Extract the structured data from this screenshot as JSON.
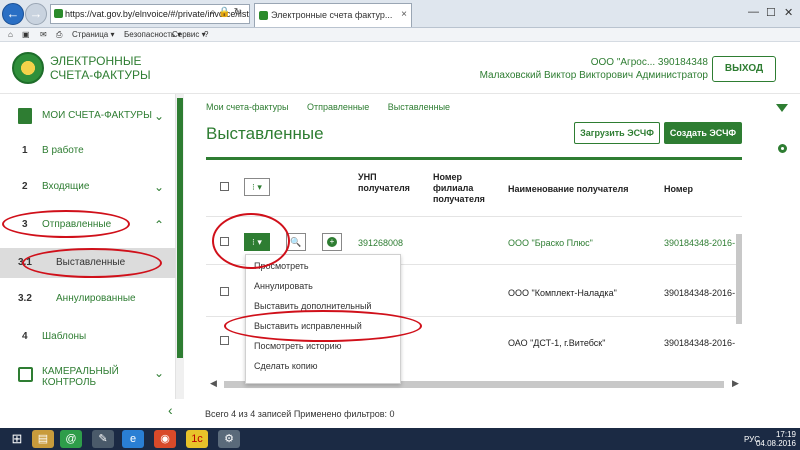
{
  "browser": {
    "url": "https://vat.gov.by/elnvoice/#/private/invoice/listAll?_k=9zpzd",
    "tab_title": "Электронные счета фактур...",
    "tab_close": "×",
    "minimize": "—",
    "maximize": "☐",
    "close": "✕",
    "cmd": {
      "page": "Страница ▾",
      "security": "Безопасность ▾",
      "service": "Сервис ▾"
    }
  },
  "header": {
    "brand": "ЭЛЕКТРОННЫЕ СЧЕТА-ФАКТУРЫ",
    "company": "ООО \"Агрос...  390184348",
    "user": "Малаховский Виктор Викторович Администратор",
    "exit_label": "ВЫХОД"
  },
  "sidebar": {
    "section_invoices": "МОИ СЧЕТА-ФАКТУРЫ",
    "items": [
      {
        "num": "1",
        "label": "В работе"
      },
      {
        "num": "2",
        "label": "Входящие"
      },
      {
        "num": "3",
        "label": "Отправленные"
      },
      {
        "num": "3.1",
        "label": "Выставленные"
      },
      {
        "num": "3.2",
        "label": "Аннулированные"
      },
      {
        "num": "4",
        "label": "Шаблоны"
      }
    ],
    "section_control": "КАМЕРАЛЬНЫЙ КОНТРОЛЬ",
    "collapse": "‹"
  },
  "main": {
    "breadcrumb": [
      "Мои счета-фактуры",
      "Отправленные",
      "Выставленные"
    ],
    "title": "Выставленные",
    "btn_load": "Загрузить ЭСЧФ",
    "btn_create": "Создать ЭСЧФ",
    "menu_btn": "⁝ ▾",
    "search_btn": "🔍",
    "plus_btn": "+",
    "columns": {
      "unp": "УНП получателя",
      "branch": "Номер филиала получателя",
      "name": "Наименование получателя",
      "number": "Номер"
    },
    "rows": [
      {
        "unp": "391268008",
        "name": "ООО \"Браско Плюс\"",
        "number": "390184348-2016-"
      },
      {
        "unp": "",
        "name": "ООО \"Комплект-Наладка\"",
        "number": "390184348-2016-"
      },
      {
        "unp": "",
        "name": "ОАО \"ДСТ-1, г.Витебск\"",
        "number": "390184348-2016-"
      }
    ]
  },
  "dropdown": {
    "items": [
      "Просмотреть",
      "Аннулировать",
      "Выставить дополнительный",
      "Выставить исправленный",
      "Посмотреть историю",
      "Сделать копию"
    ]
  },
  "footer": {
    "text": "Всего 4 из 4 записей Применено фильтров: 0"
  },
  "taskbar": {
    "lang": "РУС",
    "time": "17:19",
    "date": "04.08.2016"
  }
}
